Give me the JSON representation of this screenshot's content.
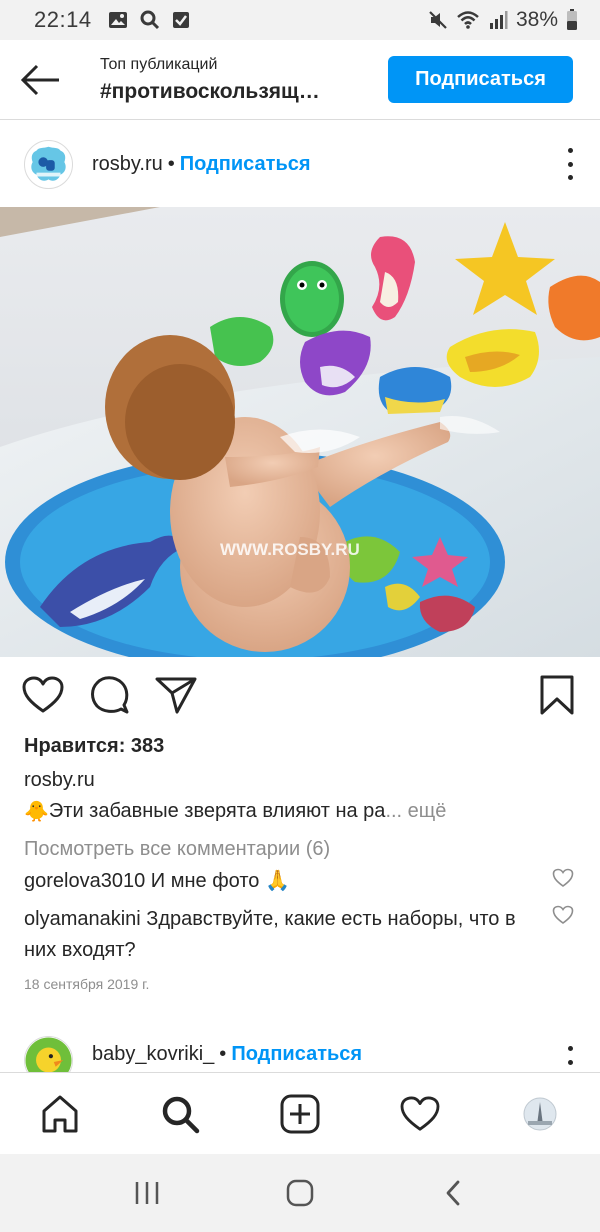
{
  "status_bar": {
    "time": "22:14",
    "battery": "38%",
    "left_icons": [
      "image-icon",
      "search-icon",
      "checkbox-icon"
    ],
    "right_icons": [
      "mute-icon",
      "wifi-icon",
      "signal-icon",
      "battery-icon"
    ]
  },
  "header": {
    "subtitle": "Топ публикаций",
    "title": "#противоскользящ…",
    "follow_label": "Подписаться"
  },
  "post": {
    "username": "rosby.ru",
    "separator": "•",
    "follow_label": "Подписаться",
    "watermark": "WWW.ROSBY.RU",
    "likes_label": "Нравится:",
    "likes_count": "383",
    "caption_user": "rosby.ru",
    "caption_emoji": "🐥",
    "caption_text": "Эти забавные зверята влияют на ра",
    "caption_more": "... ещё",
    "view_comments": "Посмотреть все комментарии (6)",
    "comments": [
      {
        "user": "gorelova3010",
        "text": "И мне фото 🙏"
      },
      {
        "user": "olyamanakini",
        "text": "Здравствуйте, какие есть наборы, что в них входят?"
      }
    ],
    "date": "18 сентября 2019 г."
  },
  "next_post": {
    "username": "baby_kovriki_",
    "separator": "•",
    "follow_label": "Подписаться"
  },
  "colors": {
    "accent": "#0095f6",
    "text": "#262626",
    "muted": "#8e8e8e",
    "border": "#dbdbdb"
  }
}
